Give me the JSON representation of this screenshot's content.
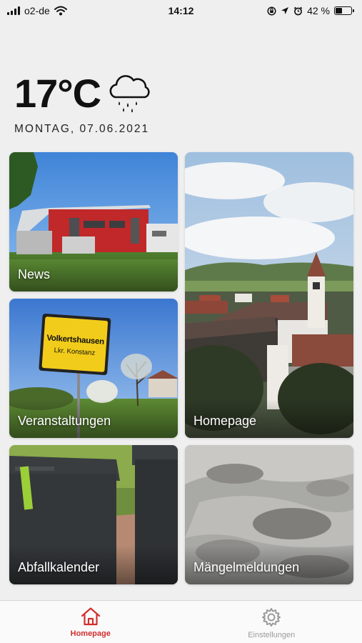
{
  "status_bar": {
    "carrier": "o2-de",
    "time": "14:12",
    "battery_percent": "42 %",
    "battery_level": 0.42,
    "icons": [
      "signal-icon",
      "wifi-icon",
      "screen-lock-icon",
      "location-icon",
      "alarm-icon",
      "battery-icon"
    ]
  },
  "weather": {
    "temperature": "17°C",
    "icon": "rain-cloud-icon",
    "date": "MONTAG, 07.06.2021"
  },
  "tiles": [
    {
      "label": "News"
    },
    {
      "label": "Homepage"
    },
    {
      "label": "Veranstaltungen",
      "sign_text": "Volkertshausen",
      "sign_subtext": "Lkr. Konstanz"
    },
    {
      "label": "Abfallkalender"
    },
    {
      "label": "Mängelmeldungen"
    }
  ],
  "tab_bar": {
    "tabs": [
      {
        "label": "Homepage",
        "icon": "home-icon",
        "active": true
      },
      {
        "label": "Einstellungen",
        "icon": "gear-icon",
        "active": false
      }
    ]
  },
  "colors": {
    "accent": "#d12f2f",
    "inactive": "#9a9a9a",
    "background": "#efefef"
  }
}
